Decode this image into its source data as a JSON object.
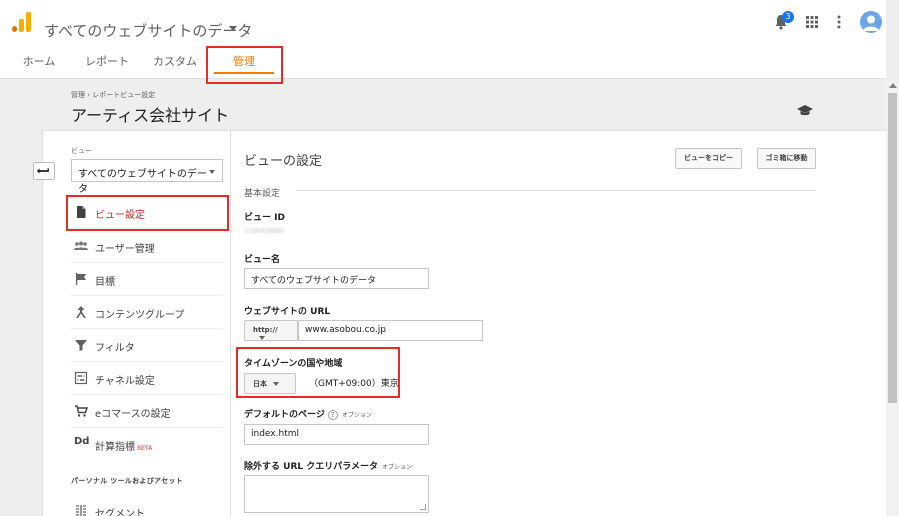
{
  "header": {
    "account_title": "すべてのウェブサイトのデータ",
    "notification_count": "3",
    "icons": [
      "analytics-logo",
      "bell-icon",
      "apps-grid-icon",
      "more-vert-icon",
      "avatar-icon"
    ]
  },
  "nav": {
    "tabs": [
      {
        "label": "ホーム"
      },
      {
        "label": "レポート"
      },
      {
        "label": "カスタム"
      },
      {
        "label": "管理"
      }
    ],
    "active_tab": "管理",
    "accent_color": "#f57c00",
    "highlight_color": "#e62b2b"
  },
  "page": {
    "breadcrumb": "管理 › レポートビュー設定",
    "title": "アーティス会社サイト"
  },
  "sidebar": {
    "view_label": "ビュー",
    "view_selected": "すべてのウェブサイトのデータ",
    "items": [
      {
        "label": "ビュー設定",
        "icon": "document-icon"
      },
      {
        "label": "ユーザー管理",
        "icon": "people-icon"
      },
      {
        "label": "目標",
        "icon": "flag-icon"
      },
      {
        "label": "コンテンツグループ",
        "icon": "content-group-icon"
      },
      {
        "label": "フィルタ",
        "icon": "filter-icon"
      },
      {
        "label": "チャネル設定",
        "icon": "channel-icon"
      },
      {
        "label": "eコマースの設定",
        "icon": "cart-icon"
      },
      {
        "label": "計算指標",
        "icon": "dd-icon",
        "prefix": "Dd",
        "beta": "BETA"
      }
    ],
    "section_label": "パーソナル ツールおよびアセット",
    "section_items": [
      {
        "label": "セグメント",
        "icon": "segment-icon"
      }
    ]
  },
  "content": {
    "title": "ビューの設定",
    "copy_button": "ビューをコピー",
    "trash_button": "ゴミ箱に移動",
    "basic_section": "基本設定",
    "view_id_label": "ビュー ID",
    "view_id_value": "118059680",
    "view_name_label": "ビュー名",
    "view_name_value": "すべてのウェブサイトのデータ",
    "url_label": "ウェブサイトの URL",
    "protocol": "http://",
    "url_value": "www.asobou.co.jp",
    "timezone_label": "タイムゾーンの国や地域",
    "country": "日本",
    "timezone": "（GMT+09:00）東京",
    "default_page_label": "デフォルトのページ",
    "default_page_help": "?",
    "default_page_opt": "オプション",
    "default_page_value": "index.html",
    "exclude_label": "除外する URL クエリパラメータ",
    "exclude_opt": "オプション"
  }
}
